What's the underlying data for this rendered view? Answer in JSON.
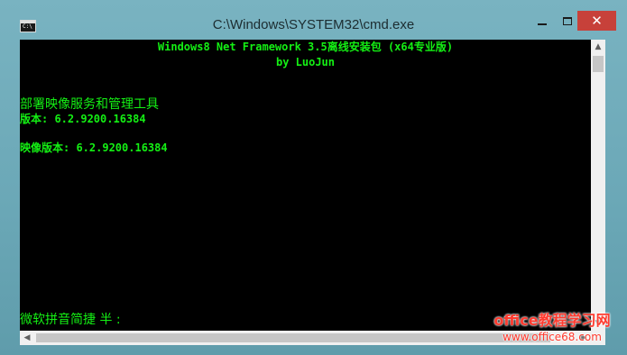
{
  "window": {
    "title": "C:\\Windows\\SYSTEM32\\cmd.exe",
    "close_label": "✕"
  },
  "console": {
    "header_line1": "Windows8 Net Framework 3.5离线安装包 (x64专业版)",
    "header_line2": "by LuoJun",
    "tool_name": "部署映像服务和管理工具",
    "tool_version": "版本: 6.2.9200.16384",
    "image_version": "映像版本: 6.2.9200.16384",
    "ime_status": "微软拼音简捷 半 :"
  },
  "watermark": {
    "line1": "office教程学习网",
    "line2": "www.office68.com"
  },
  "colors": {
    "console_bg": "#000000",
    "console_text": "#14f014",
    "close_button": "#c7413a",
    "watermark": "#ff3b2f"
  },
  "icons": {
    "app": "cmd-icon",
    "minimize": "minimize-icon",
    "maximize": "maximize-icon",
    "close": "close-icon"
  }
}
